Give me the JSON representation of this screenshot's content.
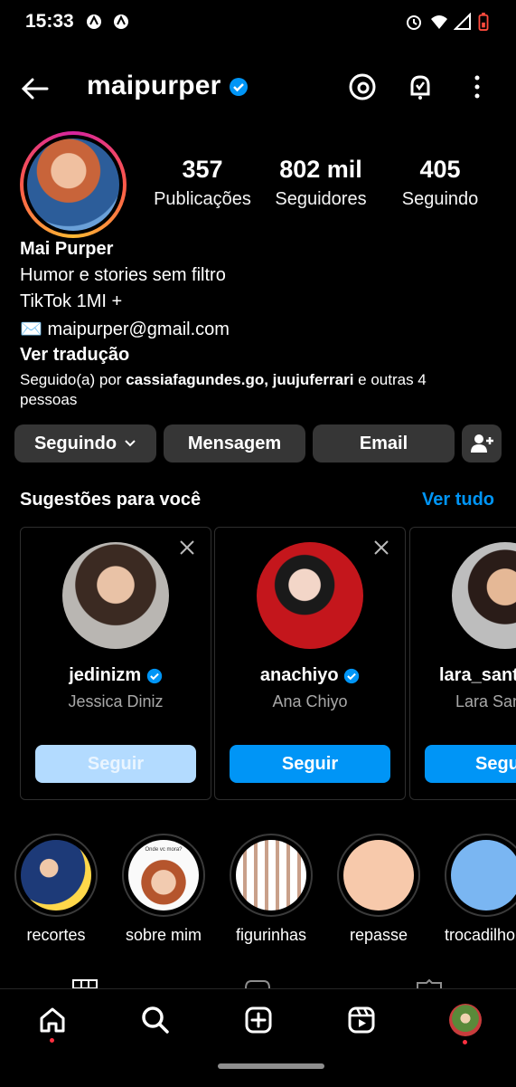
{
  "status_bar": {
    "time": "15:33"
  },
  "header": {
    "username": "maipurper",
    "verified": true
  },
  "profile": {
    "stats": [
      {
        "value": "357",
        "label": "Publicações"
      },
      {
        "value": "802 mil",
        "label": "Seguidores"
      },
      {
        "value": "405",
        "label": "Seguindo"
      }
    ],
    "name": "Mai Purper",
    "bio_line1": "Humor e stories sem filtro",
    "bio_line2": "TikTok 1MI +",
    "email": "maipurper@gmail.com",
    "email_emoji": "✉️",
    "translate": "Ver tradução",
    "followed_by_prefix": "Seguido(a) por ",
    "followed_by_users": "cassiafagundes.go, juujuferrari",
    "followed_by_suffix": " e outras 4",
    "followed_by_line2": "pessoas"
  },
  "buttons": {
    "following": "Seguindo",
    "message": "Mensagem",
    "email": "Email"
  },
  "suggestions": {
    "title": "Sugestões para você",
    "see_all": "Ver tudo",
    "cards": [
      {
        "username": "jedinizm",
        "name": "Jessica Diniz",
        "follow": "Seguir"
      },
      {
        "username": "anachiyo",
        "name": "Ana Chiyo",
        "follow": "Seguir"
      },
      {
        "username": "lara_sant",
        "name": "Lara San",
        "follow": "Segu"
      }
    ]
  },
  "highlights": [
    {
      "label": "recortes"
    },
    {
      "label": "sobre mim",
      "caption_text": "Onde vc mora?"
    },
    {
      "label": "figurinhas"
    },
    {
      "label": "repasse",
      "color": "#f7c9ab"
    },
    {
      "label": "trocadilho",
      "color": "#7ab6f2"
    }
  ],
  "colors": {
    "accent": "#0095f6",
    "button_bg": "#363636",
    "notification": "#ff3040"
  }
}
